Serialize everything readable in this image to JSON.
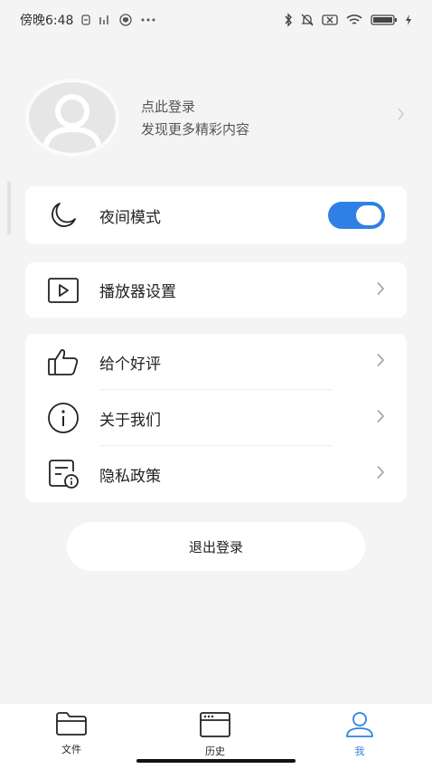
{
  "status_bar": {
    "time": "傍晚6:48",
    "icons_left": [
      "sync-icon",
      "signal-speed-icon",
      "shield-icon",
      "more-dots-icon"
    ],
    "icons_right": [
      "bluetooth-icon",
      "mute-bell-icon",
      "no-sim-icon",
      "wifi-icon",
      "battery-icon",
      "charging-icon"
    ]
  },
  "profile": {
    "title": "点此登录",
    "subtitle": "发现更多精彩内容"
  },
  "settings": {
    "night_mode": {
      "label": "夜间模式",
      "enabled": true
    },
    "player_settings": {
      "label": "播放器设置"
    },
    "rate": {
      "label": "给个好评"
    },
    "about": {
      "label": "关于我们"
    },
    "privacy": {
      "label": "隐私政策"
    }
  },
  "logout_label": "退出登录",
  "bottom_nav": {
    "items": [
      {
        "label": "文件",
        "icon": "folder-icon"
      },
      {
        "label": "历史",
        "icon": "history-window-icon"
      },
      {
        "label": "我",
        "icon": "person-icon",
        "active": true
      }
    ]
  },
  "colors": {
    "accent": "#2f80e6",
    "background": "#f4f4f4"
  }
}
